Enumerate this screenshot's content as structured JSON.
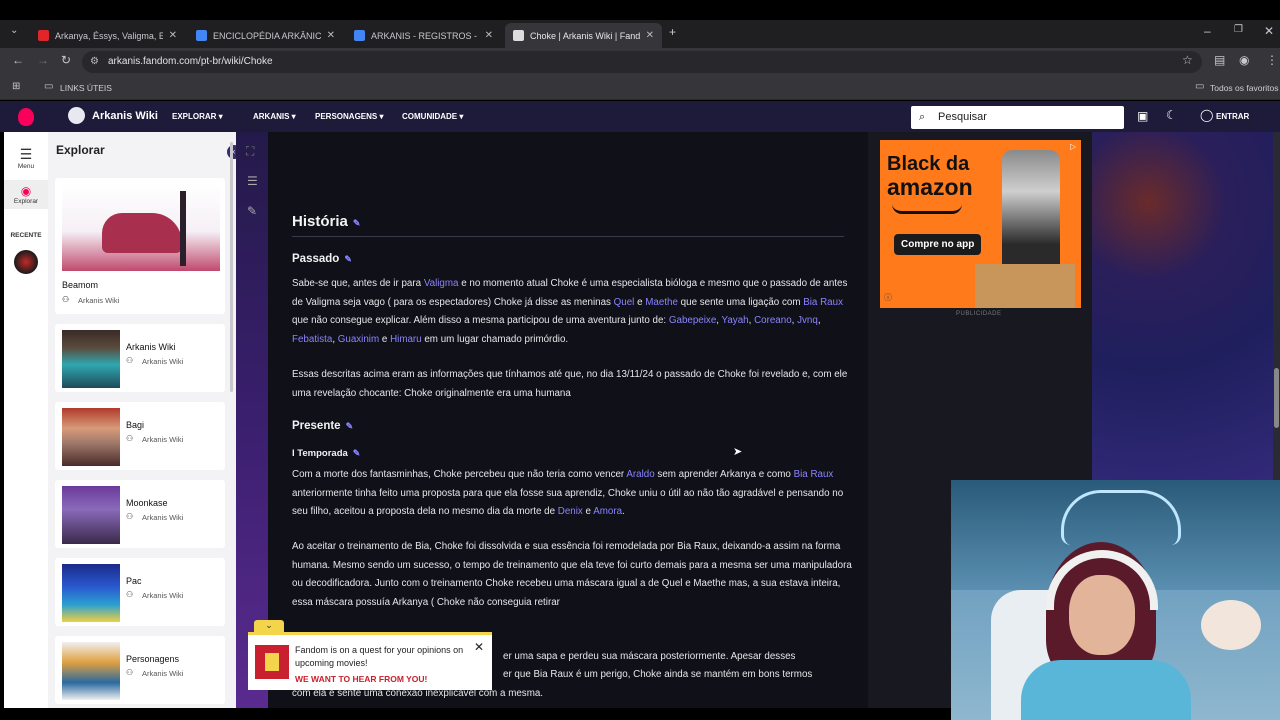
{
  "browser": {
    "tabs": [
      {
        "title": "Arkanya, Éssys, Valigma, Entidad",
        "favicon_color": "#e0262a"
      },
      {
        "title": "ENCICLOPÉDIA ARKÂNICA - De",
        "favicon_color": "#4285f4"
      },
      {
        "title": "ARKANIS - REGISTROS - Docum",
        "favicon_color": "#4285f4"
      },
      {
        "title": "Choke | Arkanis Wiki | Fandom",
        "favicon_color": "#dddddd"
      }
    ],
    "url": "arkanis.fandom.com/pt-br/wiki/Choke",
    "bookmark_folder": "LINKS ÚTEIS",
    "all_bookmarks": "Todos os favoritos"
  },
  "fandom": {
    "wiki_name": "Arkanis Wiki",
    "nav": [
      "EXPLORAR",
      "ARKANIS",
      "PERSONAGENS",
      "COMUNIDADE"
    ],
    "search_placeholder": "Pesquisar",
    "login": "ENTRAR",
    "brand_color": "#fa005a"
  },
  "rail": {
    "menu": "Menu",
    "explore": "Explorar",
    "recent": "RECENTE"
  },
  "explorer": {
    "title": "Explorar",
    "cards": [
      {
        "name": "Beamom",
        "source": "Arkanis Wiki"
      },
      {
        "name": "Arkanis Wiki",
        "source": "Arkanis Wiki"
      },
      {
        "name": "Bagi",
        "source": "Arkanis Wiki"
      },
      {
        "name": "Moonkase",
        "source": "Arkanis Wiki"
      },
      {
        "name": "Pac",
        "source": "Arkanis Wiki"
      },
      {
        "name": "Personagens",
        "source": "Arkanis Wiki"
      }
    ]
  },
  "article": {
    "h_historia": "História",
    "h_passado": "Passado",
    "p1": {
      "a": "Sabe-se que, antes de ir para ",
      "l_valigma": "Valigma",
      "b": " e no momento atual Choke é uma especialista bióloga e mesmo que o passado de antes de Valigma seja vago ( para os espectadores) Choke já disse as meninas ",
      "l_quel": "Quel",
      "c": " e ",
      "l_maethe": "Maethe",
      "d": " que sente uma ligação com ",
      "l_biaraux": "Bia Raux",
      "e": " que não consegue explicar. Além disso a mesma participou de uma aventura junto de: ",
      "l_gabepeixe": "Gabepeixe",
      "l_yayah": "Yayah",
      "l_coreano": "Coreano",
      "l_jvnq": "Jvnq",
      "l_febatista": "Febatista",
      "l_guaxinim": "Guaxinim",
      "l_himaru": "Himaru",
      "f": " em um lugar chamado primórdio."
    },
    "p2": "Essas descritas acima eram as informações que tínhamos até que, no dia 13/11/24 o passado de Choke foi revelado e, com ele uma revelação chocante: Choke originalmente era uma humana",
    "h_presente": "Presente",
    "h_temporada": "I Temporada",
    "p3": {
      "a": "Com a morte dos fantasminhas, Choke percebeu que não teria como vencer ",
      "l_araldo": "Araldo",
      "b": " sem aprender Arkanya e como ",
      "l_biaraux": "Bia Raux",
      "c": " anteriormente tinha feito uma proposta para que ela fosse sua aprendiz, Choke uniu o útil ao não tão agradável e pensando no seu filho, aceitou a proposta dela no mesmo dia da morte de ",
      "l_denix": "Denix",
      "d": " e ",
      "l_amora": "Amora",
      "e": "."
    },
    "p4": "Ao aceitar o treinamento de Bia, Choke foi dissolvida e sua essência foi remodelada por Bia Raux, deixando-a assim na forma humana. Mesmo sendo um sucesso, o tempo de treinamento que ela teve foi curto demais para a mesma ser uma manipuladora ou decodificadora. Junto com o treinamento Choke recebeu uma máscara igual a de Quel e Maethe mas, a sua estava inteira, essa máscara possuía Arkanya ( Choke não conseguia retirar",
    "p5_visible": "er uma sapa e perdeu sua máscara posteriormente. Apesar desses",
    "p5b_visible": "er que Bia Raux é um perigo, Choke ainda se mantém em bons termos",
    "p5c_visible": "com ela e sente uma conexão inexplicável com a mesma."
  },
  "ad": {
    "line1": "Black da",
    "line2": "amazon",
    "cta": "Compre no app",
    "label": "PUBLICIDADE"
  },
  "popup": {
    "message": "Fandom is on a quest for your opinions on upcoming movies!",
    "cta": "WE WANT TO HEAR FROM YOU!"
  }
}
